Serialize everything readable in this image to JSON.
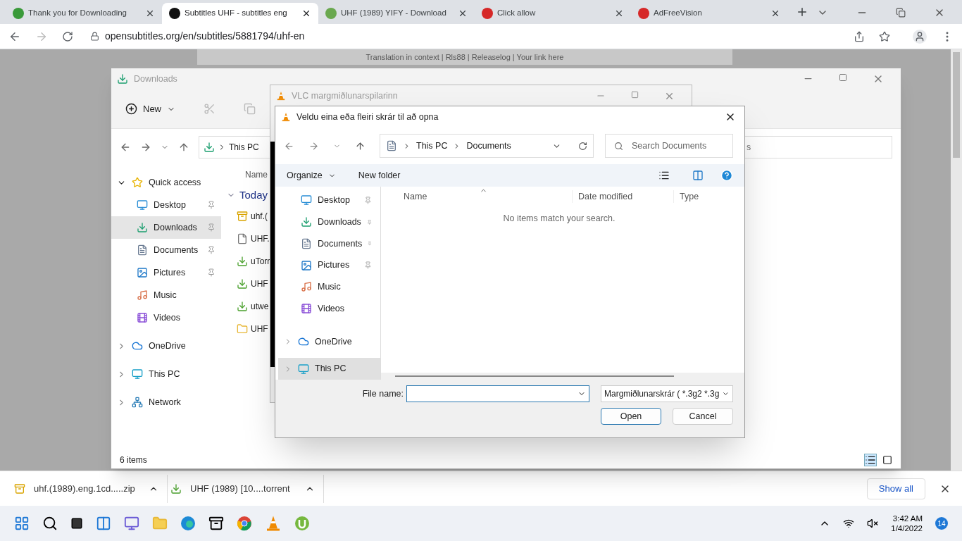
{
  "browser": {
    "tabs": [
      {
        "title": "Thank you for Downloading",
        "selected": false
      },
      {
        "title": "Subtitles UHF - subtitles eng",
        "selected": true
      },
      {
        "title": "UHF (1989) YIFY - Download",
        "selected": false
      },
      {
        "title": "Click allow",
        "selected": false
      },
      {
        "title": "AdFreeVision",
        "selected": false
      }
    ],
    "address": "opensubtitles.org/en/subtitles/5881794/uhf-en",
    "page_links": "Translation in context | Rls88 | Releaselog | Your link here"
  },
  "explorer": {
    "title": "Downloads",
    "new_label": "New",
    "breadcrumb": "This PC",
    "search_fragment": "s",
    "column": "Name",
    "group": "Today",
    "sidebar": [
      {
        "label": "Quick access",
        "expanded": true,
        "children": [
          {
            "label": "Desktop",
            "pinned": true,
            "selected": false
          },
          {
            "label": "Downloads",
            "pinned": true,
            "selected": true
          },
          {
            "label": "Documents",
            "pinned": true,
            "selected": false
          },
          {
            "label": "Pictures",
            "pinned": true,
            "selected": false
          },
          {
            "label": "Music",
            "pinned": false,
            "selected": false
          },
          {
            "label": "Videos",
            "pinned": false,
            "selected": false
          }
        ]
      },
      {
        "label": "OneDrive",
        "expanded": false
      },
      {
        "label": "This PC",
        "expanded": false
      },
      {
        "label": "Network",
        "expanded": false
      }
    ],
    "files": [
      "uhf.(",
      "UHF.",
      "uTorr",
      "UHF",
      "utwe",
      "UHF"
    ],
    "status": "6 items"
  },
  "vlc": {
    "title": "VLC margmiðlunarspilarinn"
  },
  "dialog": {
    "title": "Veldu eina eða fleiri skrár til að opna",
    "path": [
      "This PC",
      "Documents"
    ],
    "search_placeholder": "Search Documents",
    "organize": "Organize",
    "new_folder": "New folder",
    "nav": [
      {
        "label": "Desktop",
        "pinned": true,
        "selected": false
      },
      {
        "label": "Downloads",
        "pinned": true,
        "selected": false
      },
      {
        "label": "Documents",
        "pinned": true,
        "selected": false
      },
      {
        "label": "Pictures",
        "pinned": true,
        "selected": false
      },
      {
        "label": "Music",
        "pinned": false,
        "selected": false
      },
      {
        "label": "Videos",
        "pinned": false,
        "selected": false
      },
      {
        "label": "OneDrive",
        "pinned": false,
        "selected": false,
        "expandable": true
      },
      {
        "label": "This PC",
        "pinned": false,
        "selected": true,
        "expandable": true
      }
    ],
    "columns": [
      "Name",
      "Date modified",
      "Type"
    ],
    "empty_message": "No items match your search.",
    "file_name_label": "File name:",
    "filter": "Margmiðlunarskrár ( *.3g2 *.3g",
    "open": "Open",
    "cancel": "Cancel"
  },
  "downloads_bar": {
    "items": [
      "uhf.(1989).eng.1cd.....zip",
      "UHF (1989) [10....torrent"
    ],
    "show_all": "Show all"
  },
  "taskbar": {
    "time": "3:42 AM",
    "date": "1/4/2022",
    "notifications": "14"
  }
}
